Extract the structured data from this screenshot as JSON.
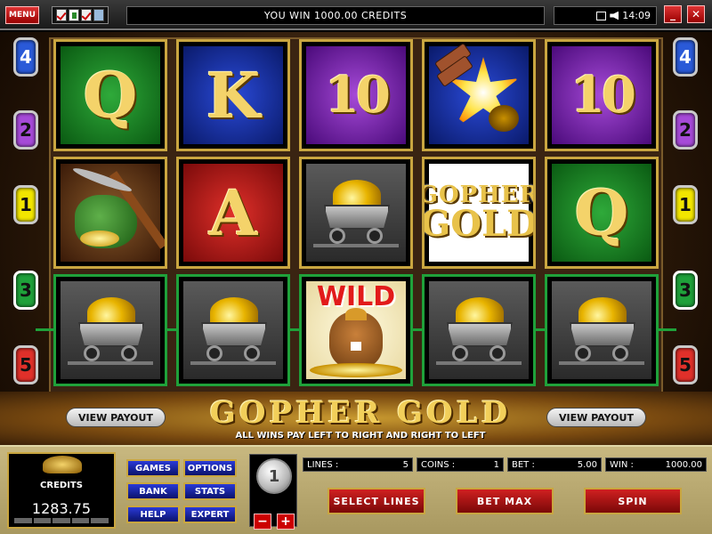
{
  "topbar": {
    "menu_label": "MENU",
    "message": "YOU WIN 1000.00 CREDITS",
    "clock": "14:09",
    "minimize_label": "_",
    "close_label": "✕"
  },
  "reels": {
    "row1": [
      "Q",
      "K",
      "10",
      "dynamite",
      "10"
    ],
    "row2": [
      "pickaxe",
      "A",
      "mine-cart",
      "gopher-gold",
      "Q"
    ],
    "row3": [
      "mine-cart",
      "mine-cart",
      "WILD",
      "mine-cart",
      "mine-cart"
    ]
  },
  "symbols": {
    "logo_line1": "GOPHER",
    "logo_line2": "GOLD",
    "wild": "WILD"
  },
  "lines": {
    "left": [
      "4",
      "2",
      "1",
      "3",
      "5"
    ],
    "right": [
      "4",
      "2",
      "1",
      "3",
      "5"
    ],
    "colors": {
      "1": "#f2e600",
      "2": "#a64ad8",
      "3": "#1fa13a",
      "4": "#2a5ad8",
      "5": "#e0302a"
    }
  },
  "title": {
    "name": "GOPHER GOLD",
    "subtitle": "ALL WINS PAY LEFT TO RIGHT AND RIGHT TO LEFT",
    "view_payout_left": "VIEW PAYOUT",
    "view_payout_right": "VIEW PAYOUT"
  },
  "panel": {
    "credits_label": "CREDITS",
    "credits_value": "1283.75",
    "buttons": {
      "games": "GAMES",
      "options": "OPTIONS",
      "bank": "BANK",
      "stats": "STATS",
      "help": "HELP",
      "expert": "EXPERT"
    },
    "coin_value": "1",
    "minus": "−",
    "plus": "+",
    "lines_label": "LINES :",
    "lines_value": "5",
    "coins_label": "COINS :",
    "coins_value": "1",
    "bet_label": "BET :",
    "bet_value": "5.00",
    "win_label": "WIN :",
    "win_value": "1000.00",
    "select_lines": "SELECT LINES",
    "bet_max": "BET MAX",
    "spin": "SPIN"
  }
}
